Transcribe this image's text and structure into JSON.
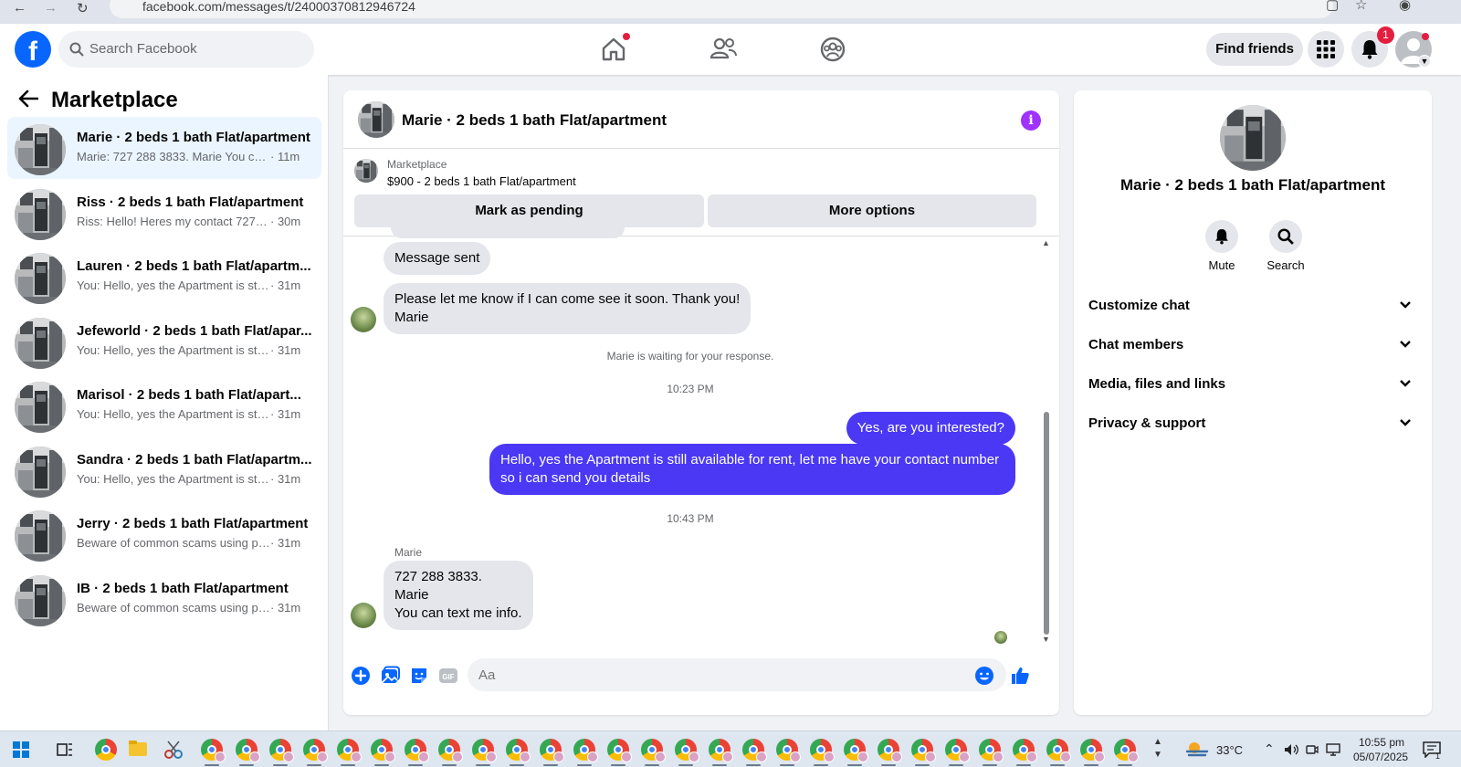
{
  "browser": {
    "url": "facebook.com/messages/t/24000370812946724"
  },
  "header": {
    "search_placeholder": "Search Facebook",
    "find_friends": "Find friends",
    "notification_count": "1"
  },
  "sidebar": {
    "title": "Marketplace",
    "conversations": [
      {
        "name": "Marie · 2 beds 1 bath Flat/apartment",
        "preview": "Marie: 727 288 3833. Marie You can...",
        "time": "· 11m"
      },
      {
        "name": "Riss · 2 beds 1 bath Flat/apartment",
        "preview": "Riss: Hello! Heres my contact 727-8...",
        "time": "· 30m"
      },
      {
        "name": "Lauren · 2 beds 1 bath Flat/apartm...",
        "preview": "You: Hello, yes the Apartment is still ...",
        "time": "· 31m"
      },
      {
        "name": "Jefeworld · 2 beds 1 bath Flat/apar...",
        "preview": "You: Hello, yes the Apartment is still ...",
        "time": "· 31m"
      },
      {
        "name": "Marisol · 2 beds 1 bath Flat/apart...",
        "preview": "You: Hello, yes the Apartment is still ...",
        "time": "· 31m"
      },
      {
        "name": "Sandra · 2 beds 1 bath Flat/apartm...",
        "preview": "You: Hello, yes the Apartment is still ...",
        "time": "· 31m"
      },
      {
        "name": "Jerry · 2 beds 1 bath Flat/apartment",
        "preview": "Beware of common scams using pa...",
        "time": "· 31m"
      },
      {
        "name": "IB · 2 beds 1 bath Flat/apartment",
        "preview": "Beware of common scams using pa...",
        "time": "· 31m"
      }
    ]
  },
  "chat": {
    "title": "Marie · 2 beds 1 bath Flat/apartment",
    "listing": {
      "category": "Marketplace",
      "title": "$900 - 2 beds 1 bath Flat/apartment",
      "mark_pending": "Mark as pending",
      "more_options": "More options"
    },
    "messages": {
      "m1": "Message sent",
      "m2": "Please let me know if I can come see it soon. Thank you!\nMarie",
      "waiting": "Marie is waiting for your response.",
      "time1": "10:23 PM",
      "m3": "Yes, are you interested?",
      "m4": "Hello, yes the Apartment is still available for rent, let me have your contact number so i can send you details",
      "time2": "10:43 PM",
      "sender": "Marie",
      "m5": "727 288 3833.\nMarie\nYou can text me info."
    },
    "composer_placeholder": "Aa"
  },
  "info_panel": {
    "name": "Marie · 2 beds 1 bath Flat/apartment",
    "mute": "Mute",
    "search": "Search",
    "sections": [
      "Customize chat",
      "Chat members",
      "Media, files and links",
      "Privacy & support"
    ]
  },
  "taskbar": {
    "temperature": "33°C",
    "time": "10:55 pm",
    "date": "05/07/2025"
  },
  "colors": {
    "brand": "#0866ff",
    "outgoing_bubble": "#4a38f5",
    "info_icon": "#a033ff"
  }
}
